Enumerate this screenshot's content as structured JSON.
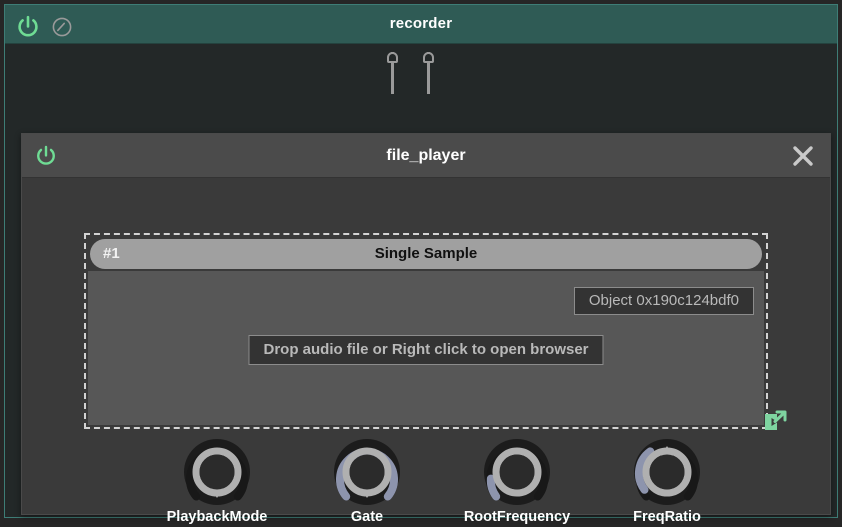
{
  "window": {
    "background_color": "#262626",
    "accent_teal": "#3e7d76"
  },
  "recorder": {
    "title": "recorder",
    "header_color": "#2f5b55",
    "power_icon": "power-icon",
    "power_color": "#6fdc94",
    "bypass_icon": "bypass-circle-icon",
    "bypass_color": "#9a9a9a",
    "top_pins": 2,
    "bottom_pins": 2
  },
  "module": {
    "title": "file_player",
    "power_icon": "power-icon",
    "close_icon": "close-icon",
    "sample": {
      "index": "#1",
      "name": "Single Sample",
      "object_id": "Object 0x190c124bdf0",
      "drop_hint": "Drop audio file or Right click to open browser",
      "expand_icon": "expand-arrow-icon",
      "expand_color": "#7ed4a0"
    },
    "knobs": [
      {
        "label": "PlaybackMode",
        "value_pct": 0,
        "arc_color": "#8d94ad",
        "ring_color": "#b0b0b0"
      },
      {
        "label": "Gate",
        "value_pct": 100,
        "arc_color": "#8d94ad",
        "ring_color": "#b0b0b0"
      },
      {
        "label": "RootFrequency",
        "value_pct": 18,
        "arc_color": "#8d94ad",
        "ring_color": "#b0b0b0"
      },
      {
        "label": "FreqRatio",
        "value_pct": 22,
        "arc_color": "#8d94ad",
        "ring_color": "#b0b0b0"
      }
    ]
  }
}
